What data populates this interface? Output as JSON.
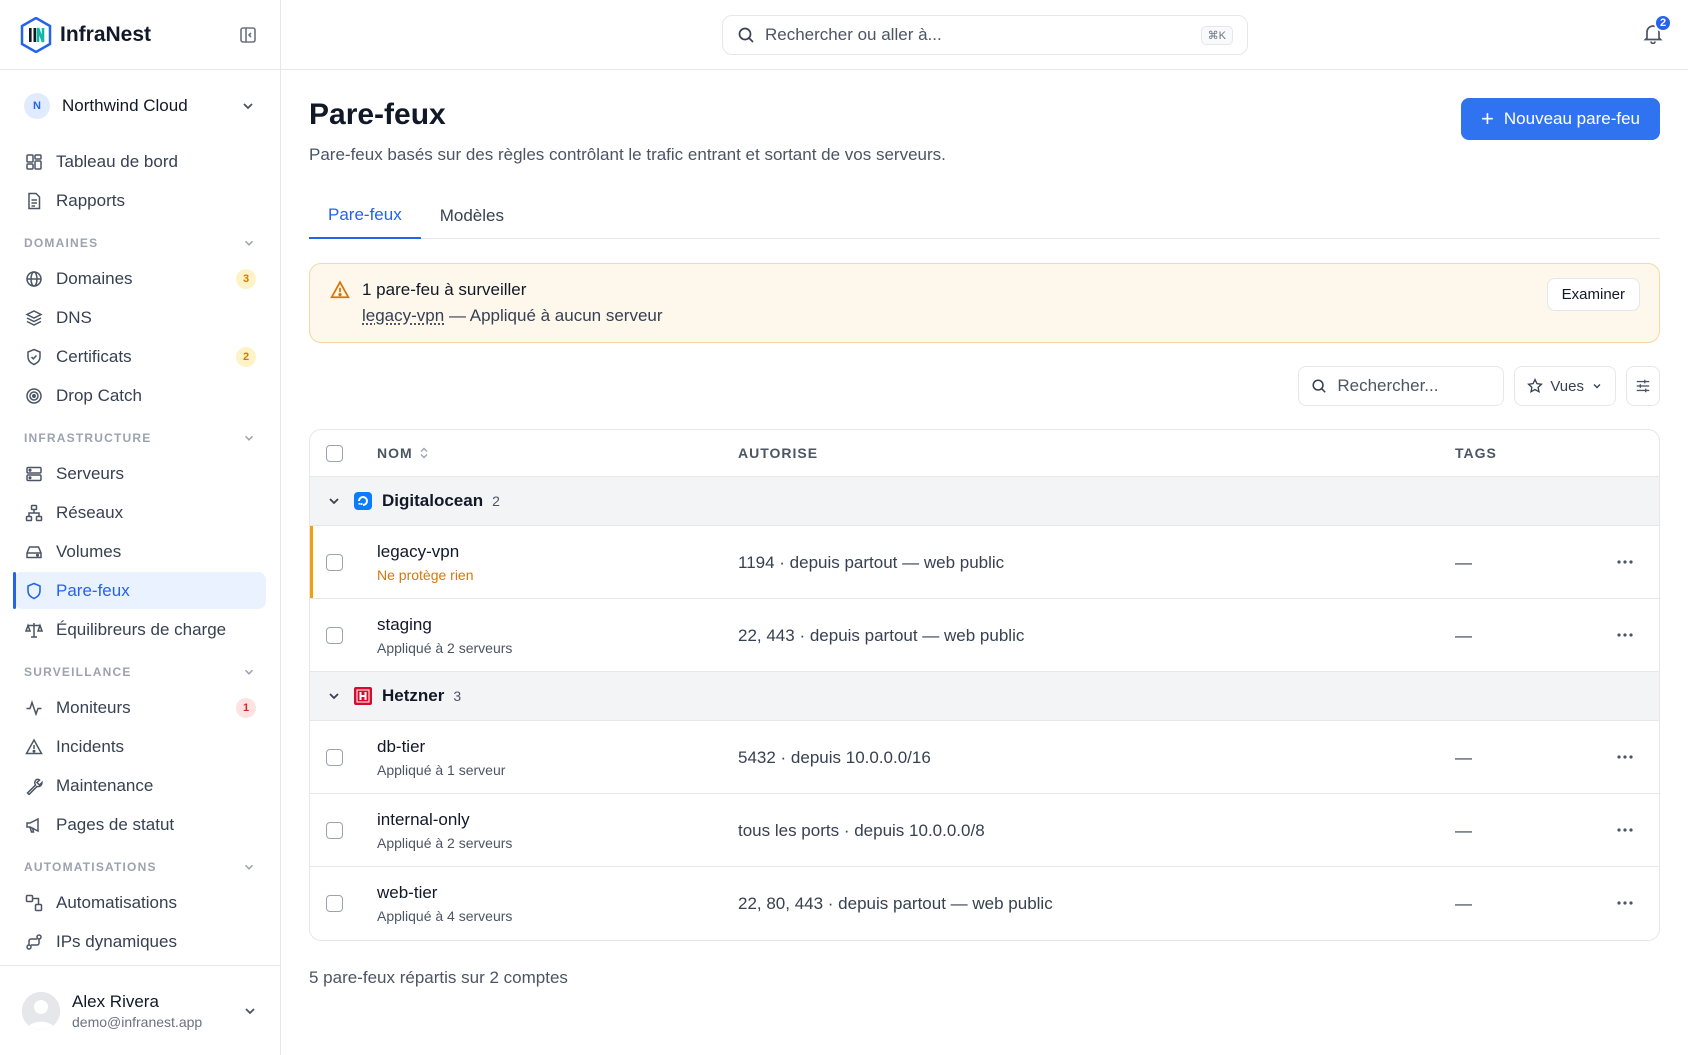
{
  "brand": {
    "name": "InfraNest"
  },
  "org": {
    "initial": "N",
    "name": "Northwind Cloud"
  },
  "nav": {
    "top": [
      {
        "label": "Tableau de bord",
        "icon": "dashboard-icon"
      },
      {
        "label": "Rapports",
        "icon": "report-icon"
      }
    ],
    "sections": [
      {
        "title": "DOMAINES",
        "items": [
          {
            "label": "Domaines",
            "icon": "globe-icon",
            "badge": "3",
            "badge_type": "warn"
          },
          {
            "label": "DNS",
            "icon": "layers-icon"
          },
          {
            "label": "Certificats",
            "icon": "shield-check-icon",
            "badge": "2",
            "badge_type": "warn"
          },
          {
            "label": "Drop Catch",
            "icon": "target-icon"
          }
        ]
      },
      {
        "title": "INFRASTRUCTURE",
        "items": [
          {
            "label": "Serveurs",
            "icon": "server-icon"
          },
          {
            "label": "Réseaux",
            "icon": "network-icon"
          },
          {
            "label": "Volumes",
            "icon": "drive-icon"
          },
          {
            "label": "Pare-feux",
            "icon": "shield-icon",
            "active": true
          },
          {
            "label": "Équilibreurs de charge",
            "icon": "scale-icon"
          }
        ]
      },
      {
        "title": "SURVEILLANCE",
        "items": [
          {
            "label": "Moniteurs",
            "icon": "activity-icon",
            "badge": "1",
            "badge_type": "err"
          },
          {
            "label": "Incidents",
            "icon": "warning-icon"
          },
          {
            "label": "Maintenance",
            "icon": "wrench-icon"
          },
          {
            "label": "Pages de statut",
            "icon": "megaphone-icon"
          }
        ]
      },
      {
        "title": "AUTOMATISATIONS",
        "items": [
          {
            "label": "Automatisations",
            "icon": "workflow-icon"
          },
          {
            "label": "IPs dynamiques",
            "icon": "dynamic-ip-icon"
          }
        ]
      }
    ]
  },
  "user": {
    "name": "Alex Rivera",
    "email": "demo@infranest.app"
  },
  "topbar": {
    "search_placeholder": "Rechercher ou aller à...",
    "shortcut": "⌘K",
    "notifications": "2"
  },
  "page": {
    "title": "Pare-feux",
    "subtitle": "Pare-feux basés sur des règles contrôlant le trafic entrant et sortant de vos serveurs.",
    "new_button": "Nouveau pare-feu",
    "tabs": [
      {
        "label": "Pare-feux",
        "active": true
      },
      {
        "label": "Modèles"
      }
    ]
  },
  "alert": {
    "title": "1 pare-feu à surveiller",
    "link": "legacy-vpn",
    "detail": " — Appliqué à aucun serveur",
    "action": "Examiner"
  },
  "filters": {
    "search_placeholder": "Rechercher...",
    "views_label": "Vues"
  },
  "table": {
    "columns": {
      "name": "NOM",
      "allowed": "AUTORISE",
      "tags": "TAGS"
    },
    "groups": [
      {
        "name": "Digitalocean",
        "count": "2",
        "logo": "digitalocean-logo",
        "rows": [
          {
            "name": "legacy-vpn",
            "sub": "Ne protège rien",
            "warn": true,
            "allowed": "1194 · depuis partout — web public",
            "tags": "—"
          },
          {
            "name": "staging",
            "sub": "Appliqué à 2 serveurs",
            "allowed": "22, 443 · depuis partout — web public",
            "tags": "—"
          }
        ]
      },
      {
        "name": "Hetzner",
        "count": "3",
        "logo": "hetzner-logo",
        "rows": [
          {
            "name": "db-tier",
            "sub": "Appliqué à 1 serveur",
            "allowed": "5432 · depuis 10.0.0.0/16",
            "tags": "—"
          },
          {
            "name": "internal-only",
            "sub": "Appliqué à 2 serveurs",
            "allowed": "tous les ports · depuis 10.0.0.0/8",
            "tags": "—"
          },
          {
            "name": "web-tier",
            "sub": "Appliqué à 4 serveurs",
            "allowed": "22, 80, 443 · depuis partout — web public",
            "tags": "—"
          }
        ]
      }
    ]
  },
  "footer": {
    "summary": "5 pare-feux répartis sur 2 comptes"
  },
  "colors": {
    "accent": "#2563eb",
    "warning": "#d97706",
    "danger": "#dc2626"
  }
}
